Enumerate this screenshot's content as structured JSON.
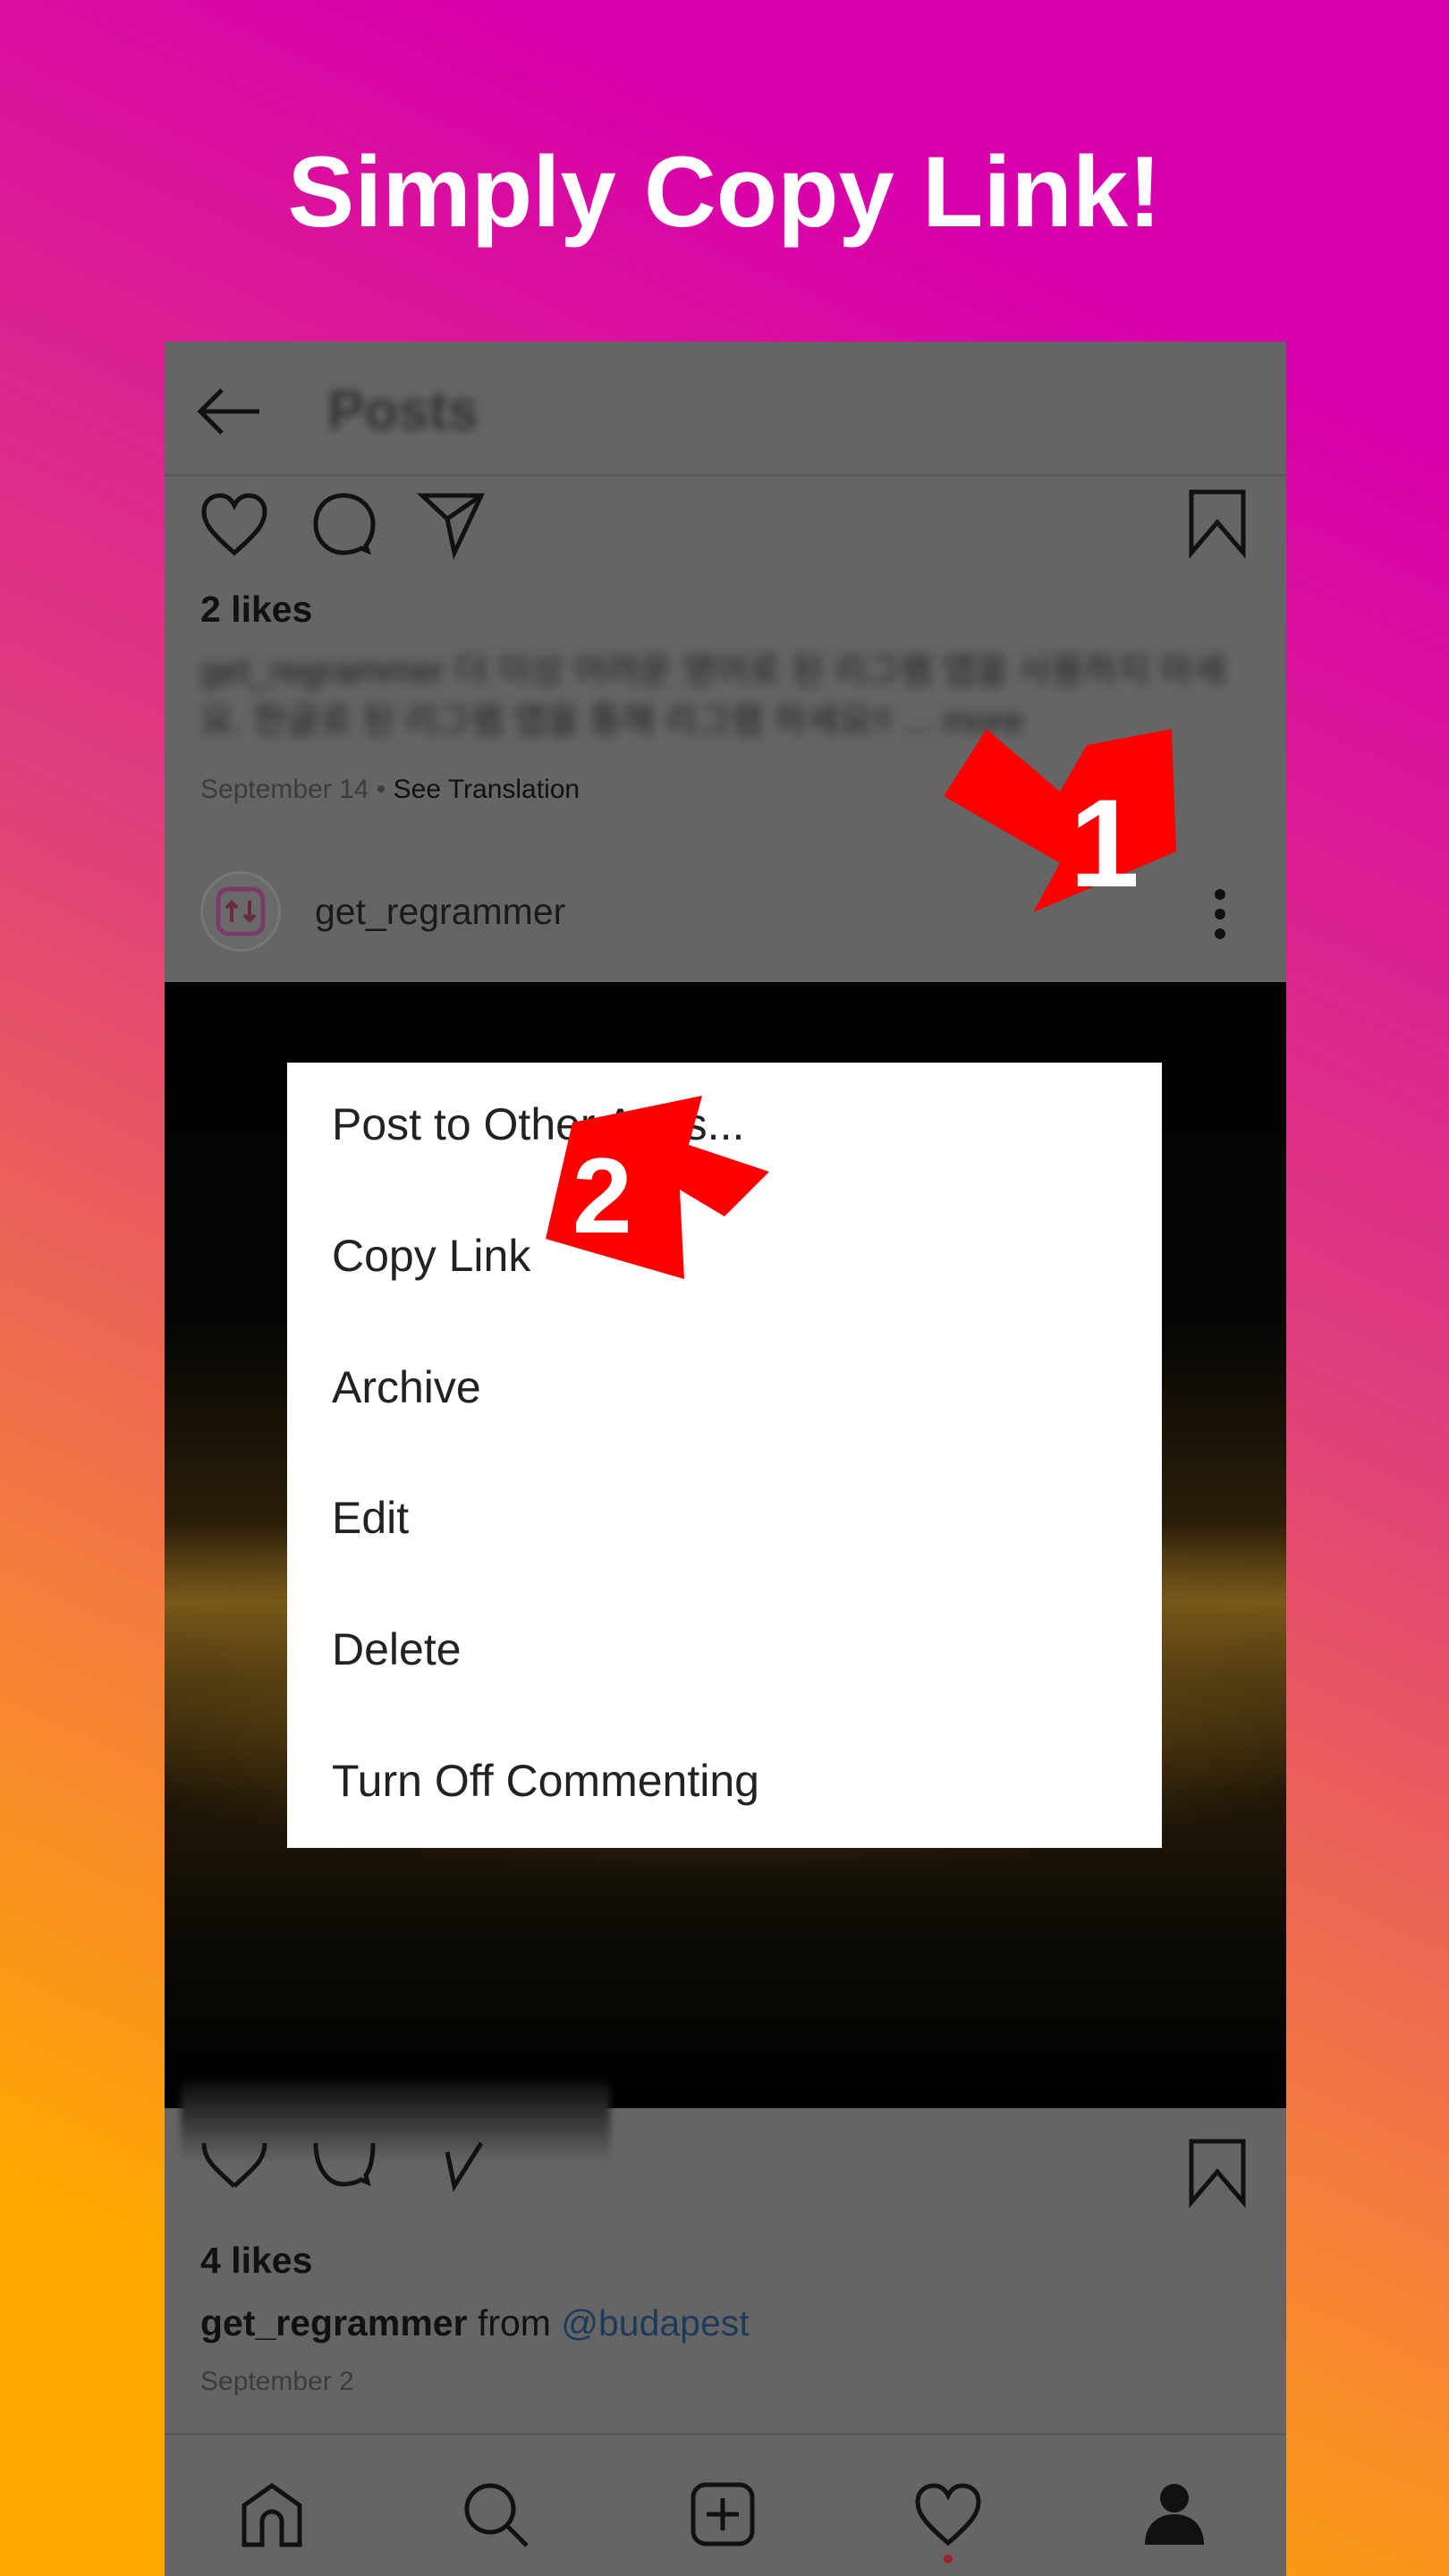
{
  "banner": {
    "title": "Simply Copy Link!"
  },
  "header": {
    "title": "Posts",
    "back_icon": "arrow-left-icon"
  },
  "post1": {
    "likes": "2 likes",
    "caption_blurred": "get_regrammer 더 이상 어려운 영어로 된 리그램 앱을 사용하지 마세요. 한글로 된 리그램 앱을 통해 리그램 하세요!! ... more",
    "date": "September 14",
    "see_translation": "See Translation"
  },
  "post2": {
    "username": "get_regrammer",
    "likes": "4 likes",
    "caption_user": "get_regrammer",
    "caption_text": "from",
    "mention": "@budapest",
    "date": "September 2",
    "mention_color": "#1e3a5a"
  },
  "menu": {
    "items": [
      "Post to Other Apps...",
      "Copy Link",
      "Archive",
      "Edit",
      "Delete",
      "Turn Off Commenting"
    ]
  },
  "annotations": {
    "step1": "1",
    "step2": "2",
    "arrow_color": "#ff0000"
  },
  "nav": {
    "items": [
      "home-icon",
      "search-icon",
      "new-post-icon",
      "activity-heart-icon",
      "profile-icon"
    ]
  }
}
